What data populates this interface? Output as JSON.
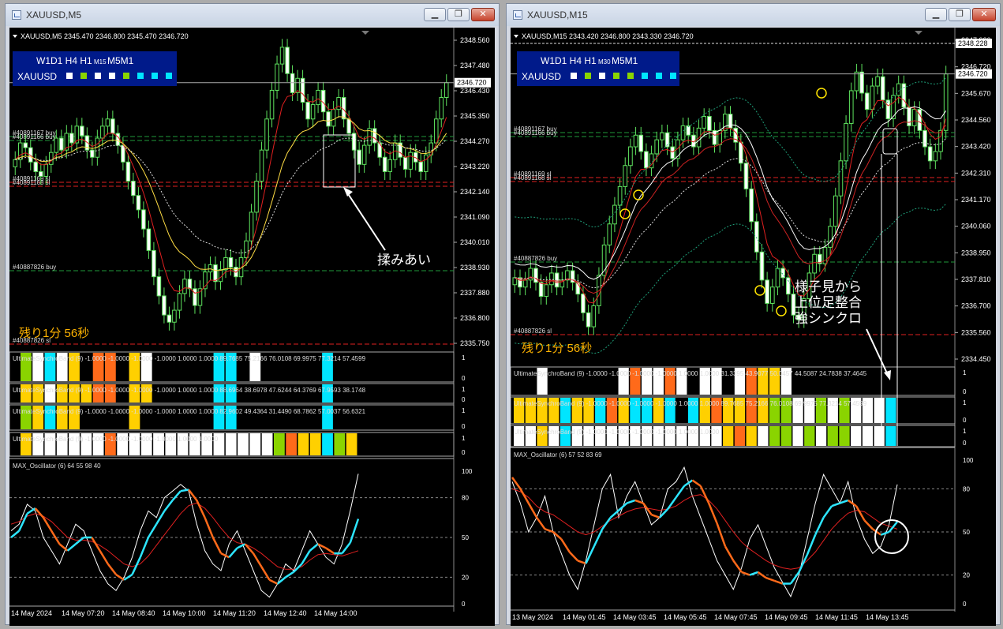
{
  "left": {
    "title": "XAUUSD,M5",
    "header": "XAUUSD,M5  2345.470 2346.800 2345.470 2346.720",
    "mtf": {
      "row1": "W1D1 H4 H1",
      "sub": "M15",
      "row1b": "M5M1",
      "symbol": "XAUUSD",
      "squares": [
        "#ffffff",
        "#8ad400",
        "#ffffff",
        "#ffffff",
        "#8ad400",
        "#00e5ff",
        "#00e5ff",
        "#00e5ff"
      ]
    },
    "yticks": [
      "2348.560",
      "2347.480",
      "2346.430",
      "2345.350",
      "2344.270",
      "2343.220",
      "2342.140",
      "2341.090",
      "2340.010",
      "2338.930",
      "2337.880",
      "2336.800",
      "2335.750"
    ],
    "price_tag": "2346.720",
    "orders": [
      "#40891167 buy",
      "#40891166 buy",
      "#40891169 sl",
      "#40891168 sl",
      "#40887826 buy",
      "#40887826 sl"
    ],
    "annotation": "揉みあい",
    "countdown": "残り1分 56秒",
    "bands": [
      "UltimateSynchroBand (9) -1.0000 -1.0000 -1.0000 -1.0000 1.0000 1.0000 89.7685 75.2166 76.0108 69.9975 77.3214 57.4599",
      "UltimateSynchroBand (9) -1.0000 -1.0000 -1.0000 -1.0000 1.0000 1.0000 88.6964 38.6978 47.6244 64.3769 67.9593 38.1748",
      "UltimateSynchroBand (9) -1.0000 -1.0000 -1.0000 -1.0000 1.0000 1.0000 82.9602 49.4364 31.4490 68.7862 57.0037 56.6321",
      "UltimateSynchroBand (9) -1.0000 -1.0000 -1.0000 -1.0000 1.0000 1.0000"
    ],
    "band_ticks": [
      "1",
      "0"
    ],
    "osc": {
      "label": "MAX_Oscillator (6) 64 55 98 40",
      "ticks": [
        "100",
        "80",
        "50",
        "20",
        "0"
      ]
    },
    "xlabels": [
      "14 May 2024",
      "14 May 07:20",
      "14 May 08:40",
      "14 May 10:00",
      "14 May 11:20",
      "14 May 12:40",
      "14 May 14:00"
    ]
  },
  "right": {
    "title": "XAUUSD,M15",
    "header": "XAUUSD,M15  2343.420 2346.800 2343.330 2346.720",
    "mtf": {
      "row1": "W1D1 H4 H1",
      "sub": "M30",
      "row1b": "M5M1",
      "symbol": "XAUUSD",
      "squares": [
        "#ffffff",
        "#8ad400",
        "#ffffff",
        "#8ad400",
        "#8ad400",
        "#00e5ff",
        "#00e5ff",
        "#00e5ff"
      ]
    },
    "yticks": [
      "2347.920",
      "2346.720",
      "2345.670",
      "2344.560",
      "2343.420",
      "2342.310",
      "2341.170",
      "2340.060",
      "2338.950",
      "2337.810",
      "2336.700",
      "2335.560",
      "2334.450"
    ],
    "price_tag": "2346.720",
    "price_tag2": "2348.228",
    "orders": [
      "#40891167 buy",
      "#40891166 buy",
      "#40891169 sl",
      "#40891168 sl",
      "#40887826 buy",
      "#40887826 sl"
    ],
    "annotation": [
      "様子見から",
      "上位足整合",
      "強シンクロ"
    ],
    "countdown": "残り1分 56秒",
    "bands": [
      "UltimateSynchroBand (9) -1.0000 -1.0000 -1.0000 -1.0000 1.0000 1.0000 31.3395 43.9077 50.0457 44.5087 24.7838 37.4645",
      "UltimateSynchroBand (9) -1.0000 -1.0000 -1.0000 -1.0000 1.0000 1.0000 89.7685 75.2166 76.0108 69.9975 77.3214 57.4599",
      "UltimateSynchroBand (9) -1.0000 -1.0000 -1.0000 -1.0000 1.0000 1.0000"
    ],
    "band_ticks": [
      "1",
      "0"
    ],
    "osc": {
      "label": "MAX_Oscillator (6) 57 52 83 69",
      "ticks": [
        "100",
        "80",
        "50",
        "20",
        "0"
      ]
    },
    "xlabels": [
      "13 May 2024",
      "14 May 01:45",
      "14 May 03:45",
      "14 May 05:45",
      "14 May 07:45",
      "14 May 09:45",
      "14 May 11:45",
      "14 May 13:45"
    ]
  },
  "colors": {
    "bull": "#5ee35e",
    "bear": "#5ee35e",
    "cyan": "#2de6ff",
    "orange": "#ff6a1a",
    "red": "#e02020",
    "lime": "#8ad400",
    "yellow": "#ffd000",
    "white": "#ffffff"
  },
  "chart_data": [
    {
      "type": "candlestick",
      "title": "XAUUSD,M5",
      "ylim": [
        2335.75,
        2348.56
      ],
      "close": [
        2343.5,
        2344.2,
        2344.0,
        2343.4,
        2343.0,
        2342.8,
        2343.3,
        2343.8,
        2344.4,
        2343.9,
        2344.6,
        2344.2,
        2344.9,
        2344.5,
        2343.9,
        2343.6,
        2344.4,
        2344.9,
        2345.2,
        2344.6,
        2344.1,
        2343.4,
        2342.6,
        2342.0,
        2341.4,
        2340.6,
        2339.7,
        2338.6,
        2337.8,
        2337.0,
        2336.7,
        2337.2,
        2337.9,
        2338.5,
        2338.1,
        2337.4,
        2338.1,
        2338.8,
        2339.1,
        2338.4,
        2338.9,
        2339.4,
        2339.0,
        2338.6,
        2339.4,
        2340.1,
        2341.3,
        2342.6,
        2343.9,
        2345.2,
        2346.4,
        2347.5,
        2348.2,
        2347.1,
        2346.3,
        2346.9,
        2345.9,
        2345.2,
        2345.8,
        2346.4,
        2345.5,
        2344.9,
        2345.6,
        2346.1,
        2345.2,
        2344.6,
        2343.9,
        2343.3,
        2344.1,
        2344.8,
        2344.2,
        2343.6,
        2343.0,
        2343.5,
        2344.2,
        2343.6,
        2343.1,
        2343.8,
        2343.4,
        2343.0,
        2343.7,
        2344.2,
        2345.2,
        2346.1,
        2346.72
      ],
      "bands_colors": [
        [
          "#8ad400",
          "#ffffff",
          "#00e5ff",
          "#ffffff",
          "#ffd000",
          "#000",
          "#ff6a1a",
          "#ff6a1a",
          "#000",
          "#ffd000",
          "#ffffff",
          "#000",
          "#000",
          "#000",
          "#000",
          "#000",
          "#00e5ff",
          "#00e5ff",
          "#000",
          "#ffffff",
          "#000",
          "#000",
          "#000",
          "#000",
          "#000",
          "#00e5ff",
          "#000",
          "#000"
        ],
        [
          "#ffd000",
          "#ffd000",
          "#ffffff",
          "#ffd000",
          "#ffd000",
          "#ffd000",
          "#ff6a1a",
          "#ff6a1a",
          "#000",
          "#ffd000",
          "#ffd000",
          "#000",
          "#000",
          "#000",
          "#000",
          "#000",
          "#00e5ff",
          "#00e5ff",
          "#000",
          "#000",
          "#000",
          "#000",
          "#000",
          "#000",
          "#000",
          "#00e5ff",
          "#000",
          "#000"
        ],
        [
          "#8ad400",
          "#ffd000",
          "#00e5ff",
          "#ffd000",
          "#ffd000",
          "#000",
          "#000",
          "#000",
          "#000",
          "#ffd000",
          "#000",
          "#000",
          "#000",
          "#000",
          "#000",
          "#000",
          "#00e5ff",
          "#00e5ff",
          "#000",
          "#000",
          "#000",
          "#000",
          "#000",
          "#000",
          "#000",
          "#00e5ff",
          "#000",
          "#000"
        ],
        [
          "#ffd000",
          "#ffffff",
          "#ffffff",
          "#ffffff",
          "#ffffff",
          "#ffffff",
          "#ffffff",
          "#ff6a1a",
          "#ffffff",
          "#ffffff",
          "#ffffff",
          "#ffffff",
          "#ffffff",
          "#ffffff",
          "#ffffff",
          "#ffffff",
          "#ffffff",
          "#ffffff",
          "#ffffff",
          "#ffffff",
          "#ffffff",
          "#8ad400",
          "#ff6a1a",
          "#ffd000",
          "#ffd000",
          "#00e5ff",
          "#8ad400",
          "#ffd000"
        ]
      ],
      "osc": {
        "ylim": [
          0,
          100
        ],
        "fast": [
          55,
          60,
          75,
          70,
          50,
          40,
          30,
          45,
          60,
          55,
          40,
          25,
          15,
          10,
          20,
          35,
          55,
          70,
          65,
          80,
          85,
          90,
          85,
          60,
          40,
          30,
          25,
          45,
          55,
          40,
          25,
          10,
          5,
          15,
          30,
          25,
          40,
          55,
          45,
          35,
          30,
          45,
          70,
          98
        ],
        "slow": [
          50,
          55,
          68,
          72,
          65,
          55,
          45,
          40,
          45,
          50,
          50,
          40,
          30,
          22,
          18,
          22,
          35,
          50,
          60,
          70,
          78,
          85,
          86,
          78,
          65,
          50,
          38,
          35,
          42,
          45,
          38,
          28,
          18,
          15,
          20,
          24,
          30,
          40,
          45,
          42,
          38,
          38,
          46,
          64
        ],
        "signal": [
          60,
          62,
          66,
          68,
          66,
          62,
          56,
          50,
          48,
          48,
          47,
          44,
          40,
          35,
          30,
          28,
          30,
          36,
          44,
          52,
          60,
          68,
          74,
          76,
          72,
          65,
          57,
          50,
          46,
          45,
          42,
          38,
          33,
          28,
          26,
          26,
          28,
          33,
          37,
          38,
          37,
          36,
          38,
          40
        ]
      }
    },
    {
      "type": "candlestick",
      "title": "XAUUSD,M15",
      "ylim": [
        2334.45,
        2348.228
      ],
      "close": [
        2338.0,
        2337.6,
        2337.9,
        2338.4,
        2337.8,
        2337.2,
        2337.7,
        2338.2,
        2337.6,
        2337.9,
        2338.3,
        2337.8,
        2337.3,
        2336.5,
        2335.9,
        2336.8,
        2338.1,
        2339.4,
        2340.3,
        2341.1,
        2341.9,
        2342.8,
        2343.6,
        2344.1,
        2343.4,
        2342.7,
        2343.3,
        2343.9,
        2344.2,
        2343.6,
        2343.1,
        2343.9,
        2344.5,
        2344.1,
        2343.6,
        2344.4,
        2344.9,
        2344.3,
        2343.7,
        2344.3,
        2345.0,
        2344.4,
        2343.8,
        2342.9,
        2341.8,
        2340.4,
        2339.1,
        2337.9,
        2336.9,
        2337.6,
        2338.4,
        2338.0,
        2337.3,
        2336.4,
        2336.2,
        2337.1,
        2338.2,
        2339.0,
        2338.6,
        2339.3,
        2340.2,
        2341.5,
        2343.0,
        2344.6,
        2346.0,
        2346.8,
        2345.9,
        2345.2,
        2346.2,
        2346.6,
        2345.6,
        2344.8,
        2345.8,
        2346.3,
        2345.3,
        2344.5,
        2345.2,
        2344.3,
        2343.6,
        2343.0,
        2343.4,
        2344.3,
        2346.72
      ],
      "bands_colors": [
        [
          "#000",
          "#000",
          "#ffffff",
          "#000",
          "#000",
          "#000",
          "#000",
          "#000",
          "#000",
          "#ffffff",
          "#ff6a1a",
          "#ffffff",
          "#ffffff",
          "#ff6a1a",
          "#ffffff",
          "#000",
          "#ffffff",
          "#ffffff",
          "#000",
          "#ffffff",
          "#ff6a1a",
          "#ffd000",
          "#ffd000",
          "#ffffff",
          "#000",
          "#000",
          "#000",
          "#000",
          "#000",
          "#000",
          "#000",
          "#000",
          "#000"
        ],
        [
          "#ffd000",
          "#ffd000",
          "#ffd000",
          "#ffd000",
          "#00e5ff",
          "#ffd000",
          "#ffd000",
          "#00e5ff",
          "#ff6a1a",
          "#ffd000",
          "#00e5ff",
          "#00e5ff",
          "#ffd000",
          "#00e5ff",
          "#000",
          "#00e5ff",
          "#ffd000",
          "#ff6a1a",
          "#ffd000",
          "#ffd000",
          "#ff6a1a",
          "#ffd000",
          "#8ad400",
          "#8ad400",
          "#ffffff",
          "#ffffff",
          "#8ad400",
          "#ffffff",
          "#8ad400",
          "#ffffff",
          "#ffffff",
          "#ffffff",
          "#00e5ff"
        ],
        [
          "#ffffff",
          "#ffffff",
          "#ffd000",
          "#ffffff",
          "#00e5ff",
          "#ffffff",
          "#ffffff",
          "#ffffff",
          "#ffffff",
          "#ffffff",
          "#ffffff",
          "#ffffff",
          "#ffffff",
          "#ffffff",
          "#ffffff",
          "#ffffff",
          "#ffffff",
          "#ffffff",
          "#ffd000",
          "#ff6a1a",
          "#ffd000",
          "#ffffff",
          "#8ad400",
          "#8ad400",
          "#ffffff",
          "#8ad400",
          "#ffffff",
          "#8ad400",
          "#8ad400",
          "#ffffff",
          "#ffffff",
          "#ffffff",
          "#00e5ff"
        ]
      ],
      "osc": {
        "ylim": [
          0,
          100
        ],
        "fast": [
          85,
          70,
          50,
          60,
          75,
          50,
          35,
          20,
          10,
          30,
          55,
          80,
          90,
          60,
          75,
          85,
          70,
          55,
          60,
          80,
          85,
          95,
          75,
          60,
          45,
          30,
          20,
          10,
          25,
          45,
          55,
          40,
          25,
          15,
          5,
          20,
          45,
          70,
          90,
          80,
          70,
          85,
          60,
          45,
          35,
          40,
          55,
          83
        ],
        "slow": [
          88,
          80,
          70,
          60,
          52,
          50,
          45,
          36,
          30,
          28,
          40,
          52,
          60,
          65,
          70,
          72,
          70,
          62,
          60,
          66,
          74,
          82,
          86,
          82,
          70,
          56,
          40,
          30,
          22,
          20,
          22,
          18,
          16,
          14,
          14,
          22,
          34,
          48,
          60,
          68,
          70,
          72,
          68,
          58,
          52,
          48,
          50,
          57
        ],
        "signal": [
          80,
          78,
          74,
          68,
          64,
          62,
          58,
          54,
          50,
          48,
          50,
          54,
          58,
          61,
          64,
          66,
          67,
          66,
          65,
          66,
          68,
          72,
          75,
          76,
          72,
          66,
          58,
          50,
          43,
          38,
          34,
          30,
          27,
          25,
          24,
          25,
          30,
          36,
          44,
          52,
          58,
          63,
          65,
          64,
          60,
          56,
          54,
          52
        ]
      }
    }
  ]
}
